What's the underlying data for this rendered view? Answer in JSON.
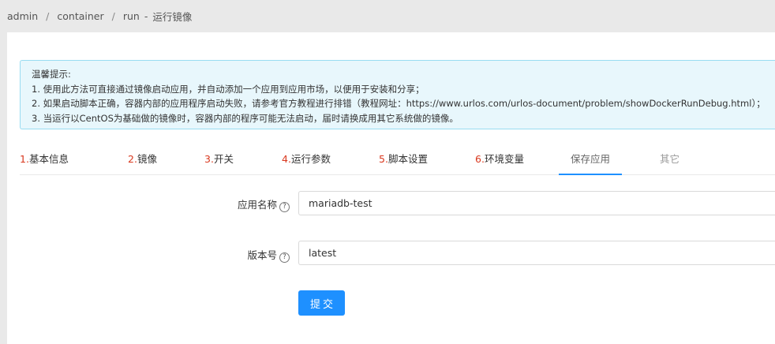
{
  "breadcrumb": {
    "items": [
      "admin",
      "container",
      "run"
    ],
    "separator": "/",
    "page_title": "运行镜像"
  },
  "notice": {
    "title": "温馨提示:",
    "lines": [
      "1. 使用此方法可直接通过镜像启动应用，并自动添加一个应用到应用市场，以便用于安装和分享；",
      "2. 如果启动脚本正确，容器内部的应用程序启动失败，请参考官方教程进行排错（教程网址：https://www.urlos.com/urlos-document/problem/showDockerRunDebug.html）；",
      "3. 当运行以CentOS为基础做的镜像时，容器内部的程序可能无法启动，届时请换成用其它系统做的镜像。"
    ]
  },
  "tabs": [
    {
      "num": "1.",
      "label": "基本信息"
    },
    {
      "num": "2.",
      "label": "镜像"
    },
    {
      "num": "3.",
      "label": "开关"
    },
    {
      "num": "4.",
      "label": "运行参数"
    },
    {
      "num": "5.",
      "label": "脚本设置"
    },
    {
      "num": "6.",
      "label": "环境变量"
    },
    {
      "num": "",
      "label": "保存应用"
    },
    {
      "num": "",
      "label": "其它"
    }
  ],
  "form": {
    "app_name_label": "应用名称",
    "app_name_value": "mariadb-test",
    "version_label": "版本号",
    "version_value": "latest",
    "help_glyph": "?",
    "submit_label": "提交"
  },
  "colors": {
    "accent": "#1e90ff",
    "step_number": "#d9381e",
    "notice_bg": "#e8f7fc",
    "notice_border": "#99dcf1"
  }
}
